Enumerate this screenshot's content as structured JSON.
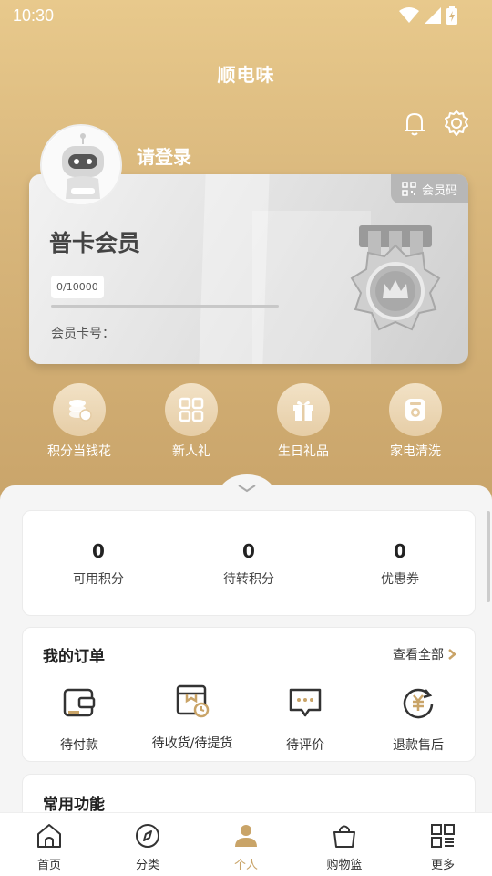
{
  "status_bar": {
    "time": "10:30"
  },
  "header": {
    "title": "顺电味"
  },
  "profile": {
    "login_prompt": "请登录"
  },
  "card": {
    "member_code_label": "会员码",
    "level": "普卡会员",
    "points_progress": "0/10000",
    "progress_fraction": 0,
    "card_number_label": "会员卡号："
  },
  "quick_actions": [
    {
      "label": "积分当钱花",
      "icon": "coins-icon"
    },
    {
      "label": "新人礼",
      "icon": "qr-gift-icon"
    },
    {
      "label": "生日礼品",
      "icon": "gift-icon"
    },
    {
      "label": "家电清洗",
      "icon": "washer-icon"
    }
  ],
  "stats": [
    {
      "value": "0",
      "label": "可用积分"
    },
    {
      "value": "0",
      "label": "待转积分"
    },
    {
      "value": "0",
      "label": "优惠券"
    }
  ],
  "orders": {
    "title": "我的订单",
    "view_all": "查看全部",
    "items": [
      {
        "label": "待付款",
        "icon": "wallet-icon"
      },
      {
        "label": "待收货/待提货",
        "icon": "box-clock-icon"
      },
      {
        "label": "待评价",
        "icon": "chat-icon"
      },
      {
        "label": "退款售后",
        "icon": "refund-icon"
      }
    ]
  },
  "common": {
    "title": "常用功能"
  },
  "tabbar": [
    {
      "label": "首页",
      "icon": "home-icon",
      "active": false
    },
    {
      "label": "分类",
      "icon": "compass-icon",
      "active": false
    },
    {
      "label": "个人",
      "icon": "person-icon",
      "active": true
    },
    {
      "label": "购物篮",
      "icon": "basket-icon",
      "active": false
    },
    {
      "label": "更多",
      "icon": "grid-icon",
      "active": false
    }
  ],
  "colors": {
    "accent": "#c9a468",
    "header_gradient_top": "#e8c98c"
  }
}
